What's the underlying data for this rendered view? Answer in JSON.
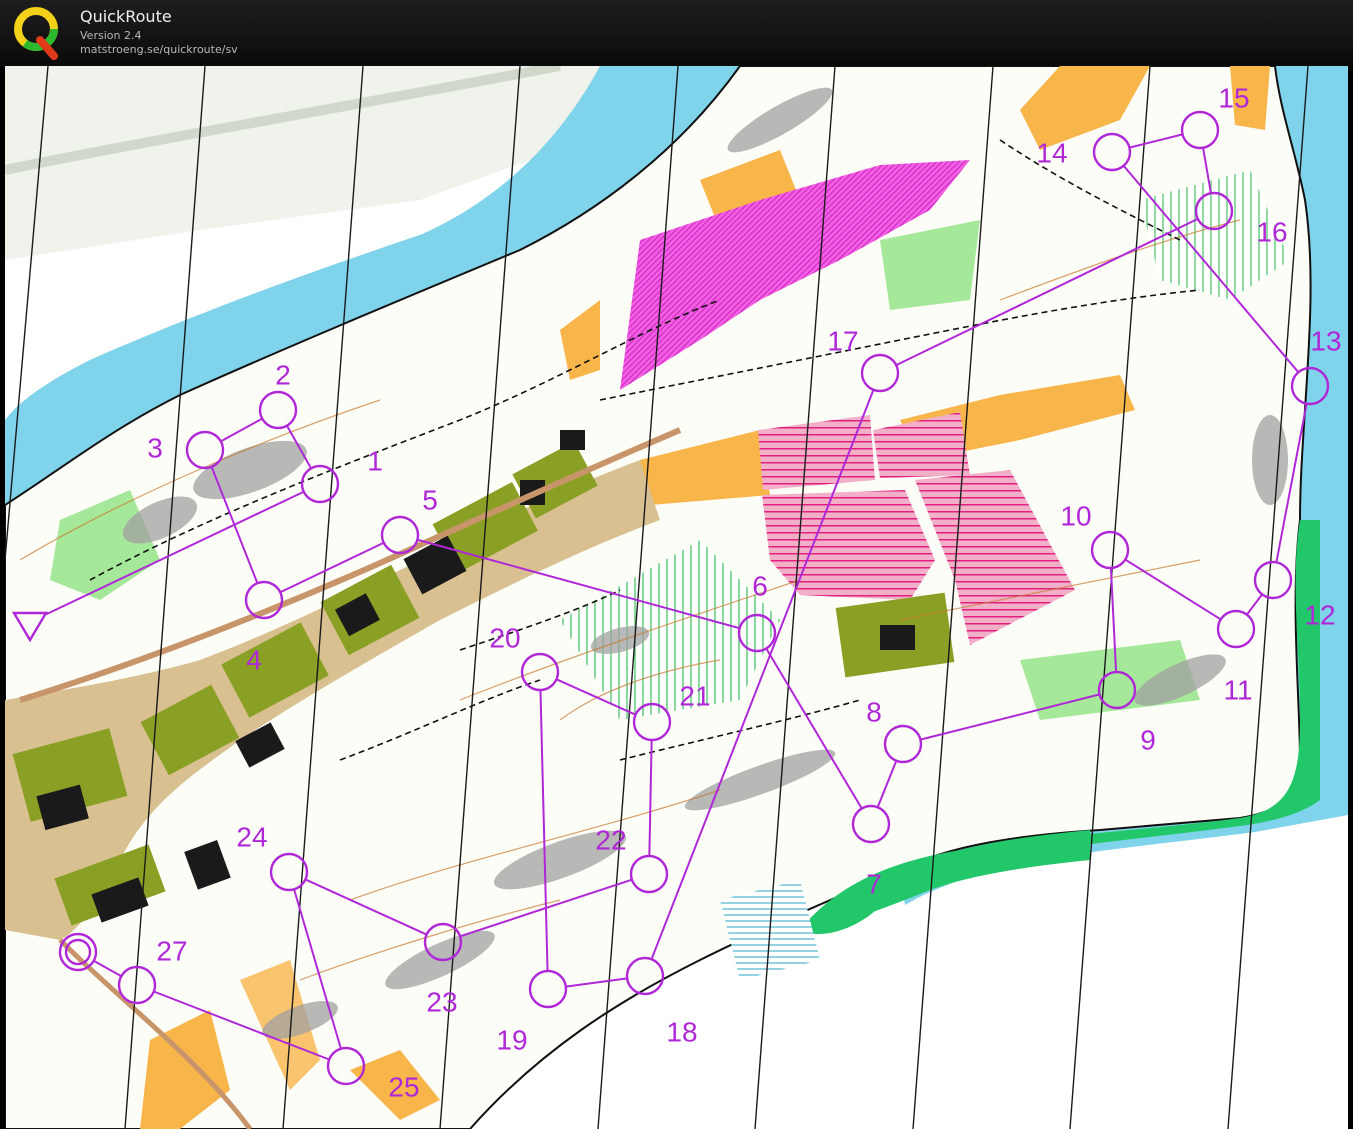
{
  "app": {
    "title": "QuickRoute",
    "version": "Version 2.4",
    "url": "matstroeng.se/quickroute/sv"
  },
  "colors": {
    "course": "#b027d8",
    "water": "#7fd3ea",
    "forest_open": "#ffffff",
    "rough_open": "#f7b54a",
    "green_dense": "#22c76a",
    "green_light": "#a6e89a",
    "out_of_bounds": "#e0217f",
    "urban": "#8aa024",
    "building": "#1a1a1a",
    "rock": "#a0a0a0"
  },
  "course": {
    "start_label": "start-triangle",
    "controls": [
      {
        "label": "1"
      },
      {
        "label": "2"
      },
      {
        "label": "3"
      },
      {
        "label": "4"
      },
      {
        "label": "5"
      },
      {
        "label": "6"
      },
      {
        "label": "7"
      },
      {
        "label": "8"
      },
      {
        "label": "9"
      },
      {
        "label": "10"
      },
      {
        "label": "11"
      },
      {
        "label": "12"
      },
      {
        "label": "13"
      },
      {
        "label": "14"
      },
      {
        "label": "15"
      },
      {
        "label": "16"
      },
      {
        "label": "17"
      },
      {
        "label": "18"
      },
      {
        "label": "19"
      },
      {
        "label": "20"
      },
      {
        "label": "21"
      },
      {
        "label": "22"
      },
      {
        "label": "23"
      },
      {
        "label": "24"
      },
      {
        "label": "25"
      },
      {
        "label": "27"
      }
    ]
  }
}
